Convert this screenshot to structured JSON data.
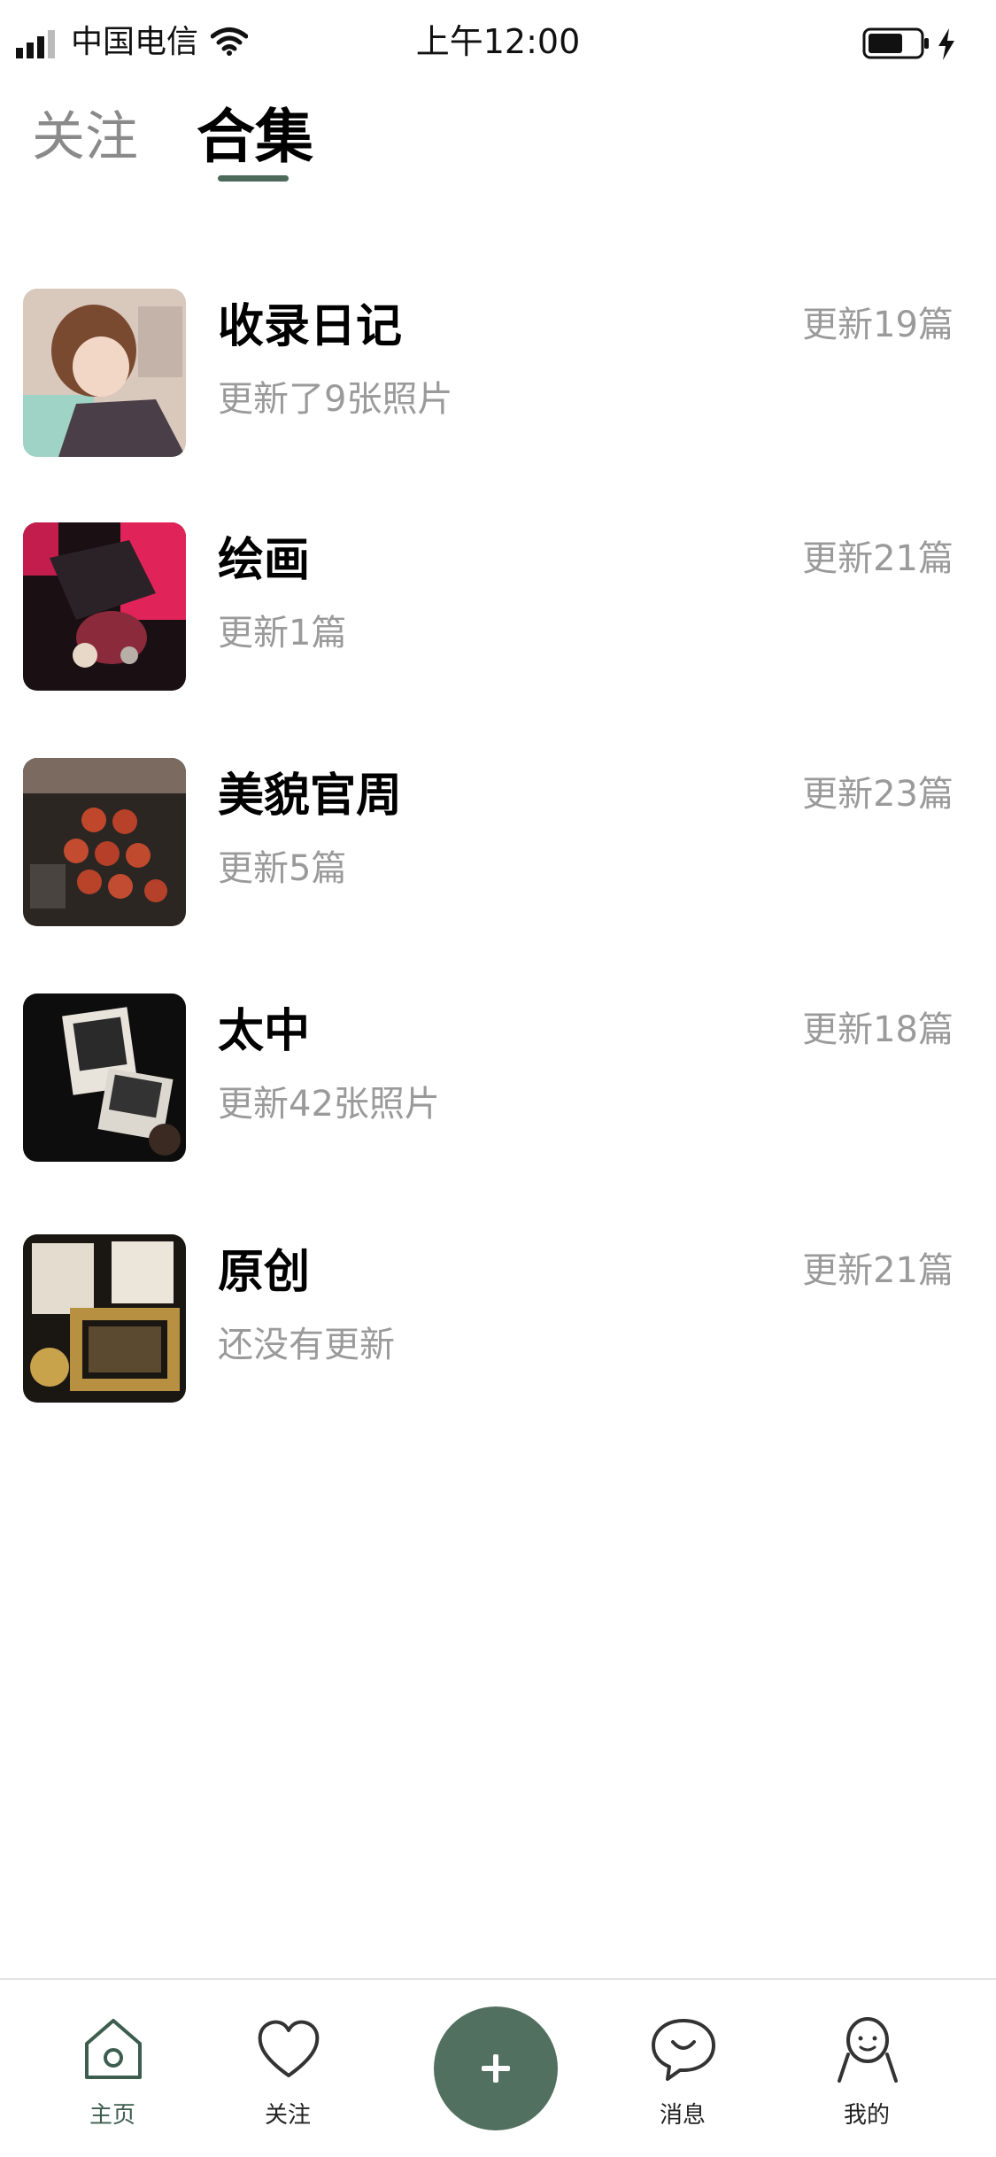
{
  "status_bar": {
    "carrier": "中国电信",
    "time": "上午12:00"
  },
  "top_tabs": {
    "follow": "关注",
    "collection": "合集",
    "active": "合集"
  },
  "collections": [
    {
      "title": "收录日记",
      "subtitle": "更新了9张照片",
      "count": "更新19篇"
    },
    {
      "title": "绘画",
      "subtitle": "更新1篇",
      "count": "更新21篇"
    },
    {
      "title": "美貌官周",
      "subtitle": "更新5篇",
      "count": "更新23篇"
    },
    {
      "title": "太中",
      "subtitle": "更新42张照片",
      "count": "更新18篇"
    },
    {
      "title": "原创",
      "subtitle": "还没有更新",
      "count": "更新21篇"
    }
  ],
  "bottom_nav": {
    "home": "主页",
    "follow": "关注",
    "messages": "消息",
    "mine": "我的"
  },
  "icons": {
    "home": "home-icon",
    "follow": "heart-icon",
    "add": "plus-icon",
    "messages": "chat-bubble-icon",
    "mine": "person-icon"
  },
  "colors": {
    "accent": "#52705f",
    "indicator": "#4b6a5b",
    "muted_text": "#9a9a9a"
  }
}
